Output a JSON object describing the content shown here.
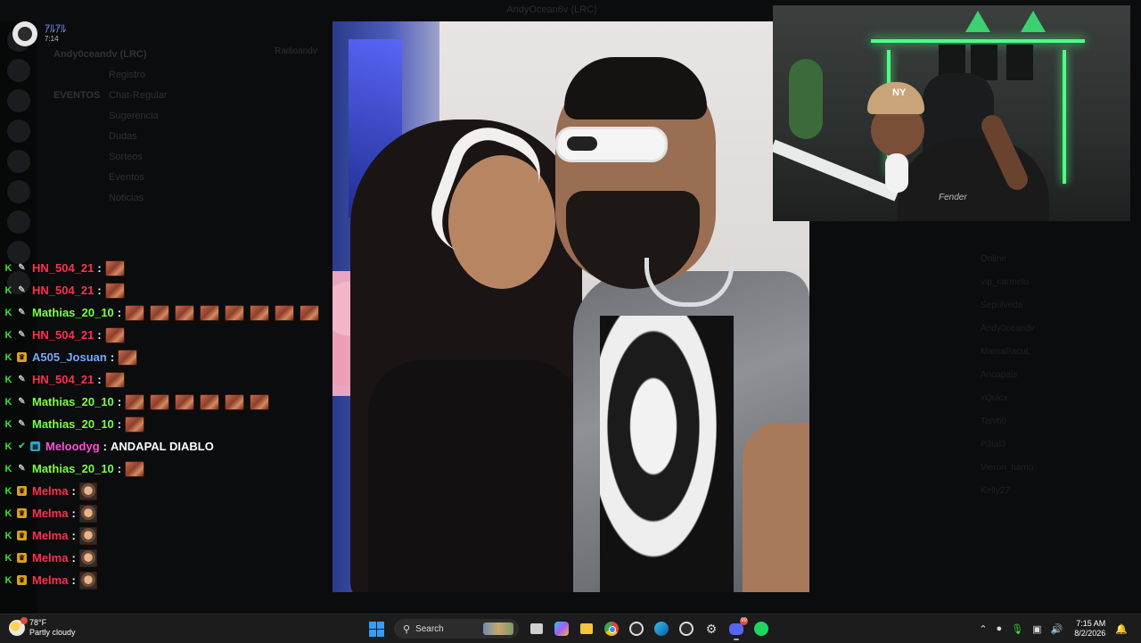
{
  "background_app": {
    "window_title": "AndyOcean6v (LRC)",
    "server_name": "Andy0ceandv (LRC)",
    "header_right": "Radioandv",
    "channels": [
      "Registro",
      "Chat-Regular",
      "Sugerencia",
      "Dudas",
      "Sorteos",
      "Eventos",
      "Noticias"
    ],
    "section_label": "EVENTOS",
    "member_list": [
      "Online",
      "vip_carmelo",
      "Sepulveda",
      "Andy0ceandv",
      "MamaPacuL",
      "Ancapals",
      "xQuicx",
      "Tahiti9",
      "P3tal3",
      "Vieron_hamu",
      "Kelly27"
    ]
  },
  "stream_header": {
    "name": "ｱﾙｱﾙ",
    "time": "7:14"
  },
  "chat": {
    "messages": [
      {
        "user": "HN_504_21",
        "color": "#ff2f4f",
        "badge": "pencil",
        "emotes": 1,
        "emote_type": "meme",
        "text": ""
      },
      {
        "user": "HN_504_21",
        "color": "#ff2f4f",
        "badge": "pencil",
        "emotes": 1,
        "emote_type": "meme",
        "text": ""
      },
      {
        "user": "Mathias_20_10",
        "color": "#79ff3c",
        "badge": "pencil",
        "emotes": 8,
        "emote_type": "meme",
        "text": ""
      },
      {
        "user": "HN_504_21",
        "color": "#ff2f4f",
        "badge": "pencil",
        "emotes": 1,
        "emote_type": "meme",
        "text": ""
      },
      {
        "user": "A505_Josuan",
        "color": "#7aa6ff",
        "badge": "crown",
        "emotes": 1,
        "emote_type": "meme",
        "text": ""
      },
      {
        "user": "HN_504_21",
        "color": "#ff2f4f",
        "badge": "pencil",
        "emotes": 1,
        "emote_type": "meme",
        "text": ""
      },
      {
        "user": "Mathias_20_10",
        "color": "#79ff3c",
        "badge": "pencil",
        "emotes": 6,
        "emote_type": "meme",
        "text": ""
      },
      {
        "user": "Mathias_20_10",
        "color": "#79ff3c",
        "badge": "pencil",
        "emotes": 1,
        "emote_type": "meme",
        "text": ""
      },
      {
        "user": "Meloodyg",
        "color": "#ff4fd8",
        "badge": "verified-og",
        "emotes": 0,
        "emote_type": "",
        "text": "ANDAPAL DIABLO"
      },
      {
        "user": "Mathias_20_10",
        "color": "#79ff3c",
        "badge": "pencil",
        "emotes": 1,
        "emote_type": "meme",
        "text": ""
      },
      {
        "user": "Melma",
        "color": "#ff2f4f",
        "badge": "crown",
        "emotes": 1,
        "emote_type": "face",
        "text": ""
      },
      {
        "user": "Melma",
        "color": "#ff2f4f",
        "badge": "crown",
        "emotes": 1,
        "emote_type": "face",
        "text": ""
      },
      {
        "user": "Melma",
        "color": "#ff2f4f",
        "badge": "crown",
        "emotes": 1,
        "emote_type": "face",
        "text": ""
      },
      {
        "user": "Melma",
        "color": "#ff2f4f",
        "badge": "crown",
        "emotes": 1,
        "emote_type": "face",
        "text": ""
      },
      {
        "user": "Melma",
        "color": "#ff2f4f",
        "badge": "crown",
        "emotes": 1,
        "emote_type": "face",
        "text": ""
      }
    ],
    "separator": ":",
    "platform_badge": "K"
  },
  "webcam": {
    "cap_logo": "NY",
    "shirt_logo": "Fender"
  },
  "taskbar": {
    "weather_temp": "78°F",
    "weather_desc": "Partly cloudy",
    "search_placeholder": "Search",
    "time": "7:15 AM",
    "date": "8/2/2026",
    "discord_badge": "99"
  },
  "colors": {
    "accent_green": "#3ce234",
    "led_green": "#4dff86",
    "taskbar_bg": "#1c1c1c"
  }
}
